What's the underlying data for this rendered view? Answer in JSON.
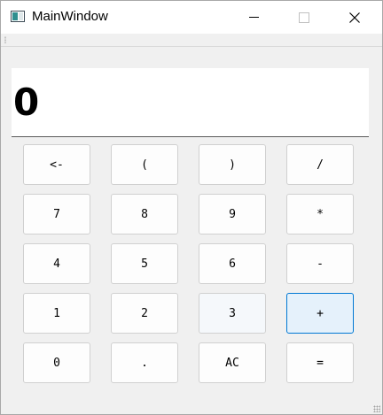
{
  "window": {
    "title": "MainWindow",
    "icon": "app-window-icon",
    "controls": {
      "minimize": "minimize-icon",
      "maximize": "maximize-icon",
      "close": "close-icon"
    }
  },
  "display": {
    "value": "0"
  },
  "keypad": {
    "rows": [
      [
        "<-",
        "(",
        ")",
        "/"
      ],
      [
        "7",
        "8",
        "9",
        "*"
      ],
      [
        "4",
        "5",
        "6",
        "-"
      ],
      [
        "1",
        "2",
        "3",
        "+"
      ],
      [
        "0",
        ".",
        "AC",
        "="
      ]
    ]
  },
  "colors": {
    "accent": "#0078d4",
    "focused_fill": "#e5f1fb"
  }
}
